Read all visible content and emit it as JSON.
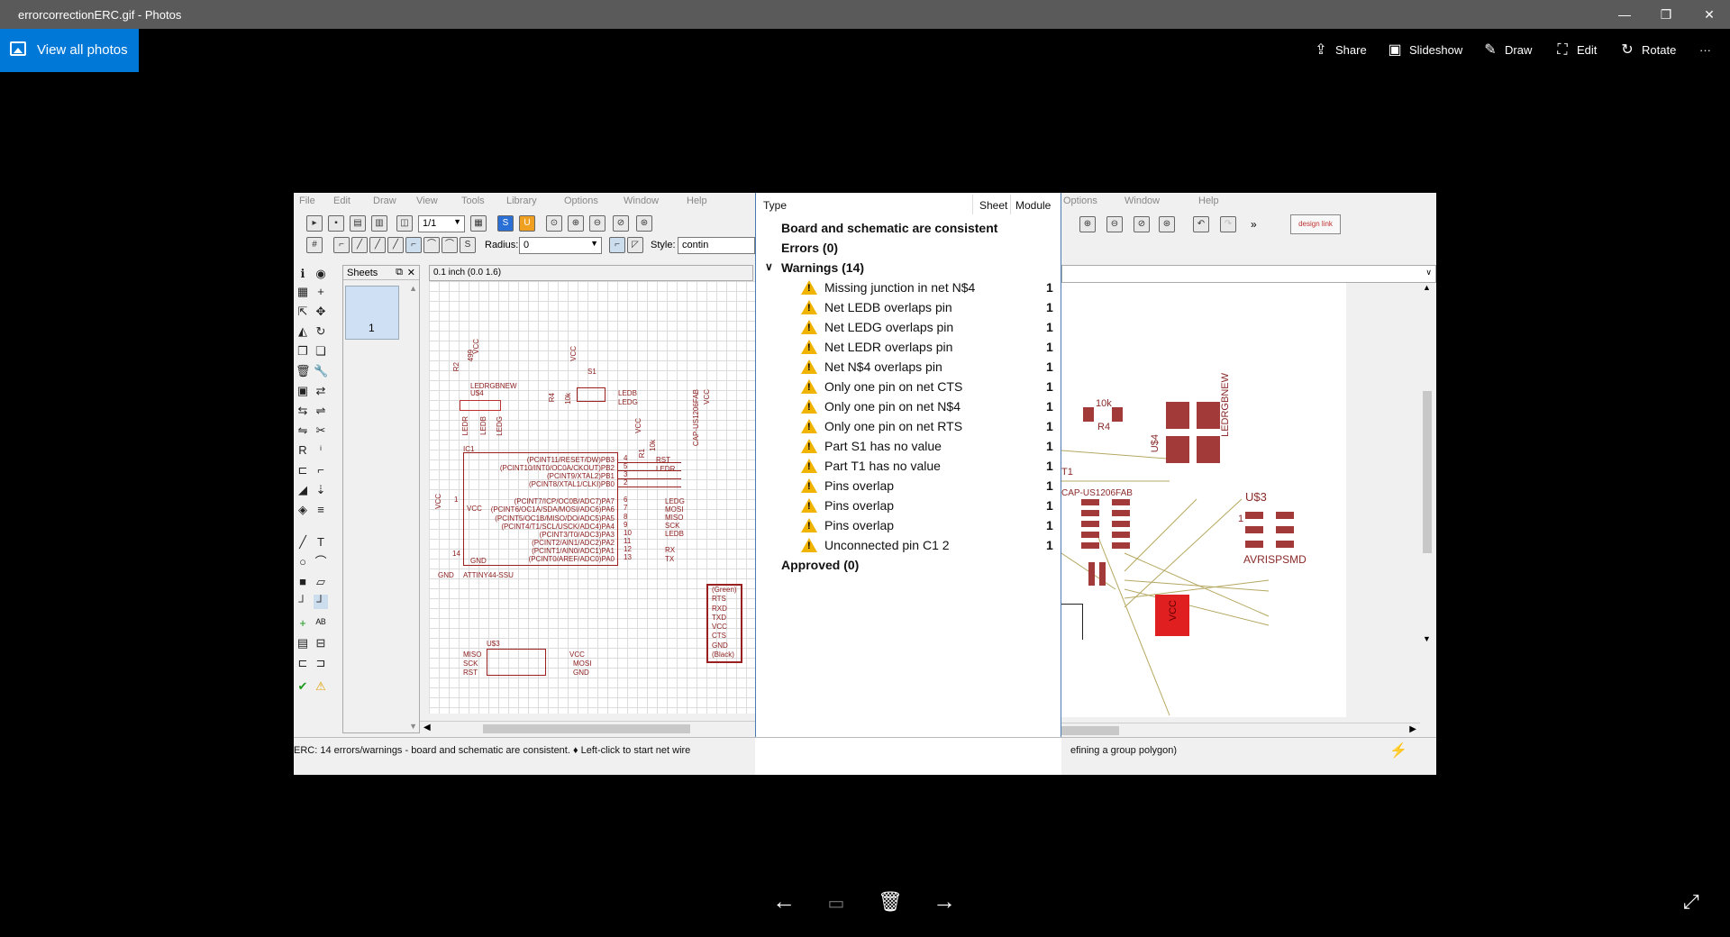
{
  "window": {
    "title": "errorcorrectionERC.gif - Photos",
    "minimize": "—",
    "restore": "❐",
    "close": "✕"
  },
  "toolbar": {
    "view_all": "View all photos",
    "share": "Share",
    "slideshow": "Slideshow",
    "draw": "Draw",
    "edit": "Edit",
    "rotate": "Rotate",
    "more": "···"
  },
  "eagle_left": {
    "menu": [
      "File",
      "Edit",
      "Draw",
      "View",
      "Tools",
      "Library",
      "Options",
      "Window",
      "Help"
    ],
    "sheet_combo": "1/1",
    "radius_label": "Radius:",
    "radius_value": "0",
    "style_label": "Style:",
    "style_value": "contin",
    "sheets_label": "Sheets",
    "sheet_number": "1",
    "coord_readout": "0.1 inch (0.0 1.6)",
    "status": "ERC: 14 errors/warnings - board and schematic are consistent.  ♦ Left-click to start net wire"
  },
  "schematic": {
    "labels": {
      "r2": "R2",
      "r2_val": "499",
      "vcc1": "VCC",
      "ledrgbnew": "LEDRGBNEW",
      "u4": "U$4",
      "r4": "R4",
      "r4_val": "10k",
      "vcc2": "VCC",
      "s1": "S1",
      "ledb": "LEDB",
      "ledg": "LEDG",
      "ledr_v": "LEDR",
      "ledb_v": "LEDB",
      "ledg_v": "LEDG",
      "vcc3": "VCC",
      "r1": "R1",
      "r1_val": "10k",
      "rst": "RST",
      "ledr": "LEDR",
      "ic1": "IC1",
      "attiny": "ATTINY44-SSU",
      "gnd_pin": "14",
      "gnd": "GND",
      "gnd_in": "GND",
      "vcc_left": "VCC",
      "vcc_pin": "1",
      "vcc_in": "VCC",
      "u3": "U$3",
      "miso": "MISO",
      "sck": "SCK",
      "rst2": "RST",
      "vcc4": "VCC",
      "mosi": "MOSI",
      "gnd2": "GND",
      "cap": "CAP-US1206FAB",
      "vcc5": "VCC"
    },
    "ic_pins": [
      "(PCINT11/RESET/DW)PB3",
      "(PCINT10/INT0/OC0A/CKOUT)PB2",
      "(PCINT9/XTAL2)PB1",
      "(PCINT8/XTAL1/CLKI)PB0",
      "(PCINT7/ICP/OC0B/ADC7)PA7",
      "(PCINT6/OC1A/SDA/MOSI/ADC6)PA6",
      "(PCINT5/OC1B/MISO/DO/ADC5)PA5",
      "(PCINT4/T1/SCL/USCK/ADC4)PA4",
      "(PCINT3/T0/ADC3)PA3",
      "(PCINT2/AIN1/ADC2)PA2",
      "(PCINT1/AIN0/ADC1)PA1",
      "(PCINT0/AREF/ADC0)PA0"
    ],
    "pin_numbers": [
      "4",
      "5",
      "3",
      "2",
      "6",
      "7",
      "8",
      "9",
      "10",
      "11",
      "12",
      "13"
    ],
    "net_labels": [
      "LEDG",
      "MOSI",
      "MISO",
      "SCK",
      "LEDB",
      "RX",
      "TX"
    ],
    "ftdi_labels": [
      "(Green)",
      "RTS",
      "RXD",
      "TXD",
      "VCC",
      "CTS",
      "GND",
      "(Black)"
    ]
  },
  "erc_dialog": {
    "columns": [
      "Type",
      "Sheet",
      "Module"
    ],
    "consistent": "Board and schematic are consistent",
    "errors": "Errors (0)",
    "warnings": "Warnings (14)",
    "approved": "Approved (0)",
    "warning_items": [
      {
        "text": "Missing junction in net N$4",
        "sheet": "1"
      },
      {
        "text": "Net LEDB overlaps pin",
        "sheet": "1"
      },
      {
        "text": "Net LEDG overlaps pin",
        "sheet": "1"
      },
      {
        "text": "Net LEDR overlaps pin",
        "sheet": "1"
      },
      {
        "text": "Net N$4 overlaps pin",
        "sheet": "1"
      },
      {
        "text": "Only one pin on net CTS",
        "sheet": "1"
      },
      {
        "text": "Only one pin on net N$4",
        "sheet": "1"
      },
      {
        "text": "Only one pin on net RTS",
        "sheet": "1"
      },
      {
        "text": "Part S1 has no value",
        "sheet": "1"
      },
      {
        "text": "Part T1 has no value",
        "sheet": "1"
      },
      {
        "text": "Pins overlap",
        "sheet": "1"
      },
      {
        "text": "Pins overlap",
        "sheet": "1"
      },
      {
        "text": "Pins overlap",
        "sheet": "1"
      },
      {
        "text": "Unconnected pin C1 2",
        "sheet": "1"
      }
    ]
  },
  "eagle_right": {
    "menu": [
      "Options",
      "Window",
      "Help"
    ],
    "designlink": "design link",
    "status": "efining a group polygon)",
    "board_labels": {
      "r4_val": "10k",
      "r4": "R4",
      "u4": "U$4",
      "ledrgbnew": "LEDRGBNEW",
      "u3": "U$3",
      "avrisp": "AVRISPSMD",
      "vcc": "VCC",
      "cap": "CAP-US1206FAB",
      "pin1": "1",
      "t1": "T1"
    }
  },
  "bottom_nav": {
    "prev": "←",
    "next": "→",
    "delete": "🗑",
    "slideshow": "▭",
    "expand": "⤢"
  }
}
